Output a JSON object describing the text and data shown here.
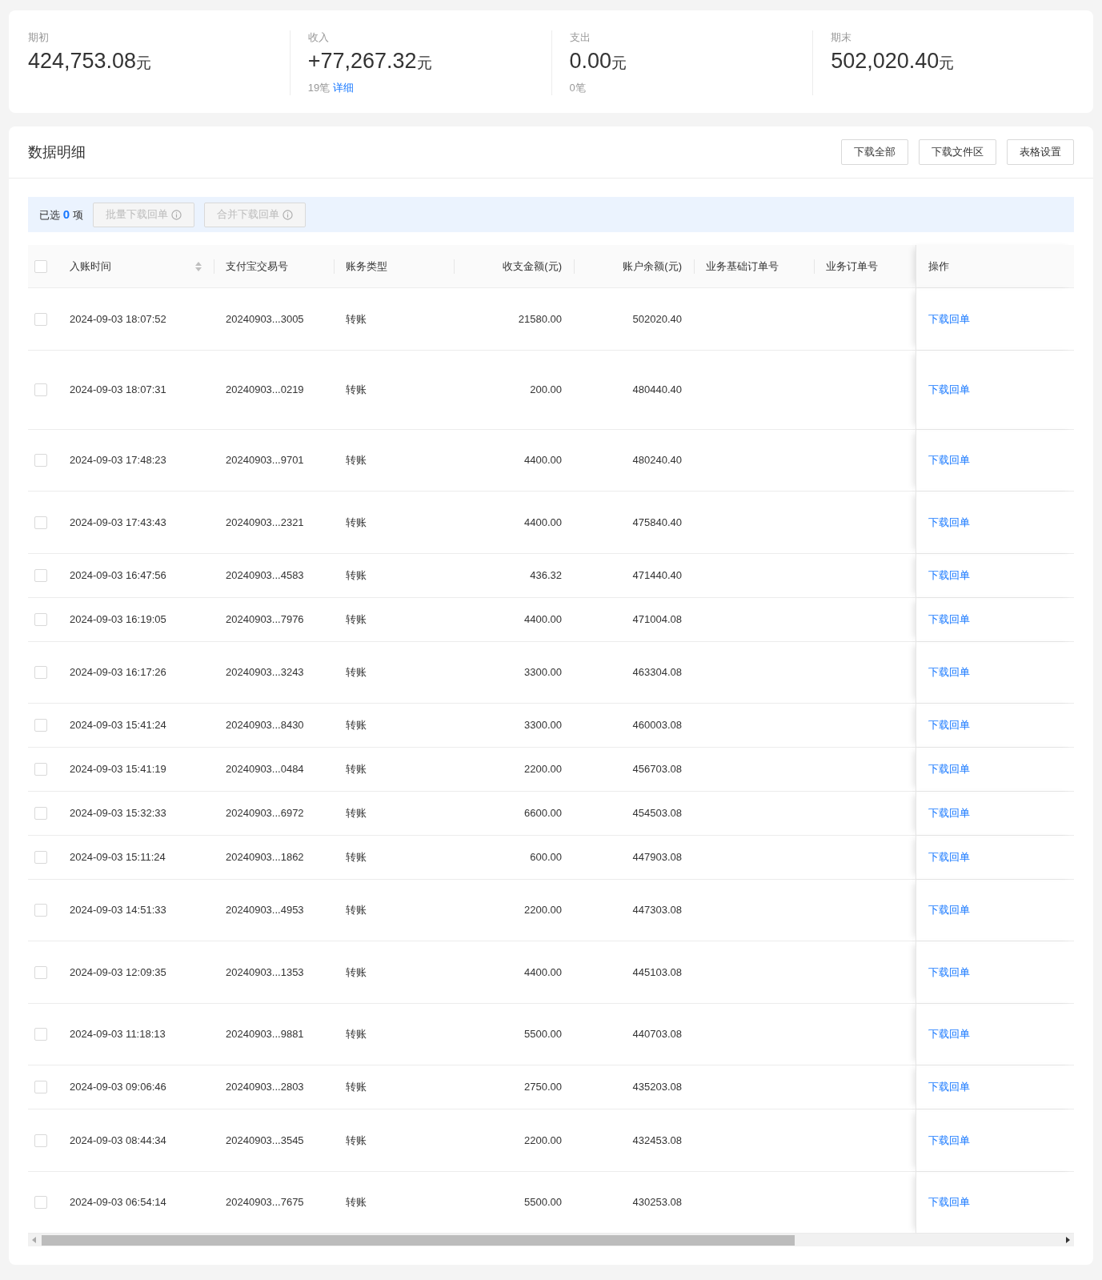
{
  "summary": [
    {
      "label": "期初",
      "amount": "424,753.08",
      "unit": "元"
    },
    {
      "label": "收入",
      "amount": "+77,267.32",
      "unit": "元",
      "count": "19笔",
      "link": "详细"
    },
    {
      "label": "支出",
      "amount": "0.00",
      "unit": "元",
      "count": "0笔"
    },
    {
      "label": "期末",
      "amount": "502,020.40",
      "unit": "元"
    }
  ],
  "panel": {
    "title": "数据明细",
    "buttons": [
      "下载全部",
      "下载文件区",
      "表格设置"
    ]
  },
  "selection": {
    "prefix": "已选",
    "count": "0",
    "suffix": "项",
    "buttons": [
      "批量下载回单",
      "合并下载回单"
    ]
  },
  "table": {
    "all_checked": false,
    "columns": [
      "入账时间",
      "支付宝交易号",
      "账务类型",
      "收支金额(元)",
      "账户余额(元)",
      "业务基础订单号",
      "业务订单号",
      "操作"
    ],
    "rows": [
      {
        "checked": false,
        "time": "2024-09-03 18:07:52",
        "trade_no": "20240903...3005",
        "type": "转账",
        "amount": "21580.00",
        "balance": "502020.40",
        "action": "下载回单"
      },
      {
        "checked": false,
        "time": "2024-09-03 18:07:31",
        "trade_no": "20240903...0219",
        "type": "转账",
        "amount": "200.00",
        "balance": "480440.40",
        "action": "下载回单"
      },
      {
        "checked": false,
        "time": "2024-09-03 17:48:23",
        "trade_no": "20240903...9701",
        "type": "转账",
        "amount": "4400.00",
        "balance": "480240.40",
        "action": "下载回单"
      },
      {
        "checked": false,
        "time": "2024-09-03 17:43:43",
        "trade_no": "20240903...2321",
        "type": "转账",
        "amount": "4400.00",
        "balance": "475840.40",
        "action": "下载回单"
      },
      {
        "checked": false,
        "time": "2024-09-03 16:47:56",
        "trade_no": "20240903...4583",
        "type": "转账",
        "amount": "436.32",
        "balance": "471440.40",
        "action": "下载回单"
      },
      {
        "checked": false,
        "time": "2024-09-03 16:19:05",
        "trade_no": "20240903...7976",
        "type": "转账",
        "amount": "4400.00",
        "balance": "471004.08",
        "action": "下载回单"
      },
      {
        "checked": false,
        "time": "2024-09-03 16:17:26",
        "trade_no": "20240903...3243",
        "type": "转账",
        "amount": "3300.00",
        "balance": "463304.08",
        "action": "下载回单"
      },
      {
        "checked": false,
        "time": "2024-09-03 15:41:24",
        "trade_no": "20240903...8430",
        "type": "转账",
        "amount": "3300.00",
        "balance": "460003.08",
        "action": "下载回单"
      },
      {
        "checked": false,
        "time": "2024-09-03 15:41:19",
        "trade_no": "20240903...0484",
        "type": "转账",
        "amount": "2200.00",
        "balance": "456703.08",
        "action": "下载回单"
      },
      {
        "checked": false,
        "time": "2024-09-03 15:32:33",
        "trade_no": "20240903...6972",
        "type": "转账",
        "amount": "6600.00",
        "balance": "454503.08",
        "action": "下载回单"
      },
      {
        "checked": false,
        "time": "2024-09-03 15:11:24",
        "trade_no": "20240903...1862",
        "type": "转账",
        "amount": "600.00",
        "balance": "447903.08",
        "action": "下载回单"
      },
      {
        "checked": false,
        "time": "2024-09-03 14:51:33",
        "trade_no": "20240903...4953",
        "type": "转账",
        "amount": "2200.00",
        "balance": "447303.08",
        "action": "下载回单"
      },
      {
        "checked": false,
        "time": "2024-09-03 12:09:35",
        "trade_no": "20240903...1353",
        "type": "转账",
        "amount": "4400.00",
        "balance": "445103.08",
        "action": "下载回单"
      },
      {
        "checked": false,
        "time": "2024-09-03 11:18:13",
        "trade_no": "20240903...9881",
        "type": "转账",
        "amount": "5500.00",
        "balance": "440703.08",
        "action": "下载回单"
      },
      {
        "checked": false,
        "time": "2024-09-03 09:06:46",
        "trade_no": "20240903...2803",
        "type": "转账",
        "amount": "2750.00",
        "balance": "435203.08",
        "action": "下载回单"
      },
      {
        "checked": false,
        "time": "2024-09-03 08:44:34",
        "trade_no": "20240903...3545",
        "type": "转账",
        "amount": "2200.00",
        "balance": "432453.08",
        "action": "下载回单"
      },
      {
        "checked": false,
        "time": "2024-09-03 06:54:14",
        "trade_no": "20240903...7675",
        "type": "转账",
        "amount": "5500.00",
        "balance": "430253.08",
        "action": "下载回单"
      }
    ]
  }
}
